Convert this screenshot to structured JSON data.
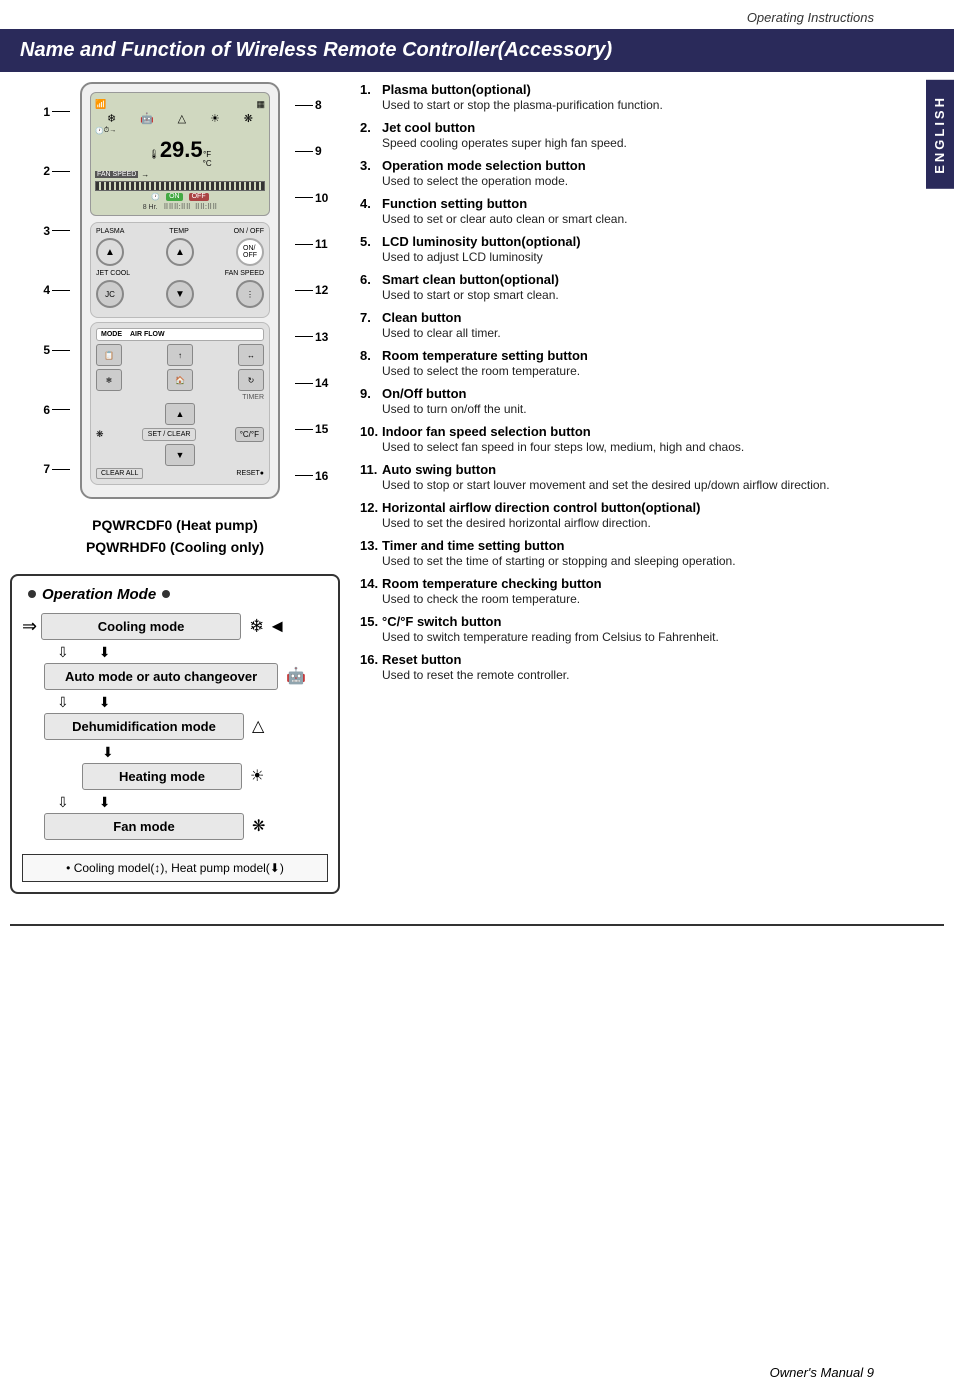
{
  "header": {
    "title": "Operating Instructions"
  },
  "title_bar": {
    "text": "Name and Function of Wireless Remote Controller(Accessory)"
  },
  "remote": {
    "temp": "29.5",
    "temp_unit": "°F/°C",
    "fan_speed_label": "FAN SPEED",
    "on_label": "ON",
    "off_label": "OFF",
    "plasma_label": "PLASMA",
    "temp_label": "TEMP",
    "on_off_label": "ON / OFF",
    "jet_cool_label": "JET COOL",
    "fan_speed_btn": "FAN SPEED",
    "mode_label": "MODE",
    "air_flow_label": "AIR FLOW",
    "timer_label": "TIMER",
    "set_label": "SET",
    "clear_label": "CLEAR",
    "clear_all_label": "CLEAR ALL",
    "reset_label": "RESET"
  },
  "left_labels": [
    {
      "num": "1",
      "position": "top-jetcool"
    },
    {
      "num": "2",
      "position": "jetcool"
    },
    {
      "num": "3",
      "position": "mode"
    },
    {
      "num": "4",
      "position": "mode2"
    },
    {
      "num": "5",
      "position": "timer"
    },
    {
      "num": "6",
      "position": "set"
    },
    {
      "num": "7",
      "position": "bottom"
    }
  ],
  "right_labels": [
    {
      "num": "8"
    },
    {
      "num": "9"
    },
    {
      "num": "10"
    },
    {
      "num": "11"
    },
    {
      "num": "12"
    },
    {
      "num": "13"
    },
    {
      "num": "14"
    },
    {
      "num": "15"
    },
    {
      "num": "16"
    }
  ],
  "model_names": {
    "line1": "PQWRCDF0 (Heat pump)",
    "line2": "PQWRHDF0 (Cooling only)"
  },
  "op_mode": {
    "title": "Operation Mode",
    "modes": [
      {
        "label": "Cooling mode",
        "icon": "❄",
        "icon_side": "right"
      },
      {
        "label": "Auto mode or auto changeover",
        "icon": "🤖",
        "icon_side": "right"
      },
      {
        "label": "Dehumidification mode",
        "icon": "△",
        "icon_side": "right"
      },
      {
        "label": "Heating mode",
        "icon": "☀",
        "icon_side": "right"
      },
      {
        "label": "Fan mode",
        "icon": "❋",
        "icon_side": "right"
      }
    ],
    "note": "• Cooling model(↕), Heat pump model(⬇)"
  },
  "numbered_list": [
    {
      "num": "1.",
      "title": "Plasma button(optional)",
      "desc": "Used to start or stop the plasma-purification function."
    },
    {
      "num": "2.",
      "title": "Jet cool button",
      "desc": "Speed cooling operates super high fan speed."
    },
    {
      "num": "3.",
      "title": "Operation mode selection button",
      "desc": "Used to select the operation mode."
    },
    {
      "num": "4.",
      "title": "Function setting button",
      "desc": "Used to set or clear auto clean or smart clean."
    },
    {
      "num": "5.",
      "title": "LCD luminosity button(optional)",
      "desc": "Used to adjust LCD luminosity"
    },
    {
      "num": "6.",
      "title": "Smart clean button(optional)",
      "desc": "Used to start or stop smart clean."
    },
    {
      "num": "7.",
      "title": "Clean button",
      "desc": "Used to clear all timer."
    },
    {
      "num": "8.",
      "title": "Room temperature setting button",
      "desc": "Used to select the room temperature."
    },
    {
      "num": "9.",
      "title": "On/Off button",
      "desc": "Used to turn on/off the unit."
    },
    {
      "num": "10.",
      "title": "Indoor fan speed selection button",
      "desc": "Used to select fan speed in four steps low, medium, high and chaos."
    },
    {
      "num": "11.",
      "title": "Auto swing button",
      "desc": "Used to stop or start louver movement and set the desired up/down airflow direction."
    },
    {
      "num": "12.",
      "title": "Horizontal airflow direction control button(optional)",
      "desc": "Used to set the desired horizontal airflow direction."
    },
    {
      "num": "13.",
      "title": "Timer and time setting button",
      "desc": "Used to set the time of starting or stopping and sleeping operation."
    },
    {
      "num": "14.",
      "title": "Room temperature checking button",
      "desc": "Used to check the room temperature."
    },
    {
      "num": "15.",
      "title": "°C/°F switch button",
      "desc": "Used to switch temperature reading from Celsius to Fahrenheit."
    },
    {
      "num": "16.",
      "title": "Reset button",
      "desc": "Used to reset the remote controller."
    }
  ],
  "side_tab": {
    "label": "ENGLISH"
  },
  "footer": {
    "text": "Owner's Manual   9"
  }
}
